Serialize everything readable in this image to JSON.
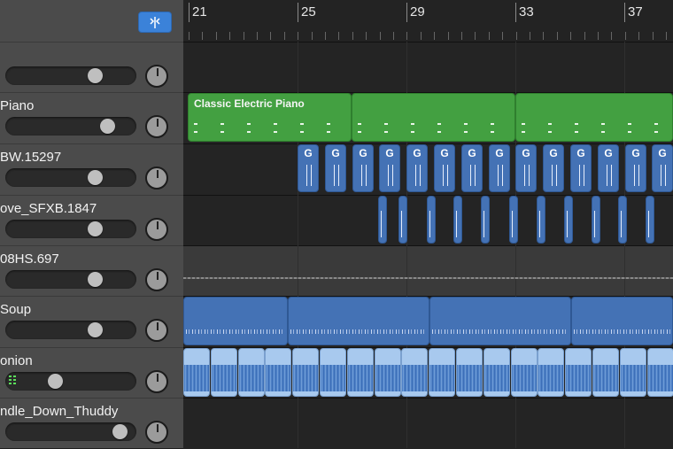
{
  "ruler": {
    "bars": [
      "21",
      "25",
      "29",
      "33",
      "37"
    ]
  },
  "toolbar": {
    "catch_icon": "playhead-catch-icon",
    "accent": "#3b82d9"
  },
  "tracks": [
    {
      "name": "",
      "volume": 0.72
    },
    {
      "name": "Piano",
      "volume": 0.83
    },
    {
      "name": "BW.15297",
      "volume": 0.72
    },
    {
      "name": "ove_SFXB.1847",
      "volume": 0.72
    },
    {
      "name": "08HS.697",
      "volume": 0.72
    },
    {
      "name": "Soup",
      "volume": 0.72
    },
    {
      "name": "onion",
      "volume": 0.36
    },
    {
      "name": "ndle_Down_Thuddy",
      "volume": 0.94
    }
  ],
  "regions": {
    "piano_title": "Classic Electric Piano",
    "drummer_letter": "G"
  },
  "colors": {
    "green_region": "#43a041",
    "blue_region": "#4472b5",
    "light_blue_region": "#a8c9ee"
  }
}
